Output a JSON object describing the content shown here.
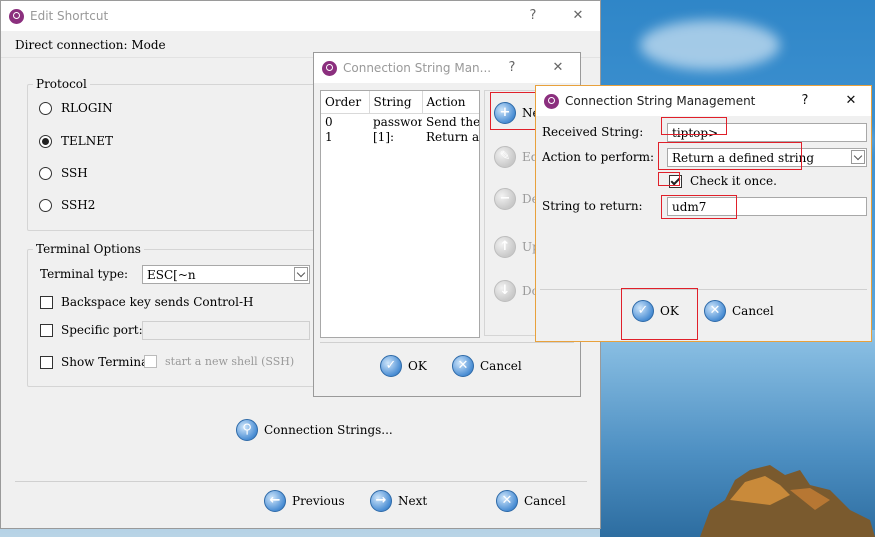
{
  "edit_shortcut": {
    "title": "Edit Shortcut",
    "help_btn": "?",
    "close_btn": "✕",
    "status": "Direct connection: Mode",
    "protocol_label": "Protocol",
    "protocols": [
      "RLOGIN",
      "TELNET",
      "SSH",
      "SSH2"
    ],
    "selected_protocol": "TELNET",
    "terminal_options_label": "Terminal Options",
    "terminal_type_label": "Terminal type:",
    "terminal_type_value": "ESC[~n",
    "backspace_label": "Backspace key sends Control-H",
    "specific_port_label": "Specific port:",
    "show_terminal_label": "Show Terminal",
    "new_shell_label": "start a new shell (SSH)",
    "connection_strings_btn": "Connection Strings...",
    "previous_btn": "Previous",
    "next_btn": "Next",
    "cancel_btn": "Cancel"
  },
  "csm_list": {
    "title": "Connection String Man...",
    "help_btn": "?",
    "close_btn": "✕",
    "columns": [
      "Order",
      "String",
      "Action"
    ],
    "rows": [
      {
        "order": "0",
        "string": "password:",
        "action": "Send the..."
      },
      {
        "order": "1",
        "string": "[1]:",
        "action": "Return a..."
      }
    ],
    "side_buttons": {
      "new": "Ne",
      "edit": "Ed",
      "delete": "De",
      "up": "Up",
      "down": "Do"
    },
    "ok_btn": "OK",
    "cancel_btn": "Cancel"
  },
  "csm_edit": {
    "title": "Connection String Management",
    "help_btn": "?",
    "close_btn": "✕",
    "received_label": "Received String:",
    "received_value": "tiptop>",
    "action_label": "Action to perform:",
    "action_value": "Return a defined string",
    "check_once_label": "Check it once.",
    "return_label": "String to return:",
    "return_value": "udm7",
    "ok_btn": "OK",
    "cancel_btn": "Cancel"
  },
  "colors": {
    "highlight": "#e0202a",
    "app_icon": "#8b2f7e",
    "button_icon": "#4b8ed4"
  }
}
